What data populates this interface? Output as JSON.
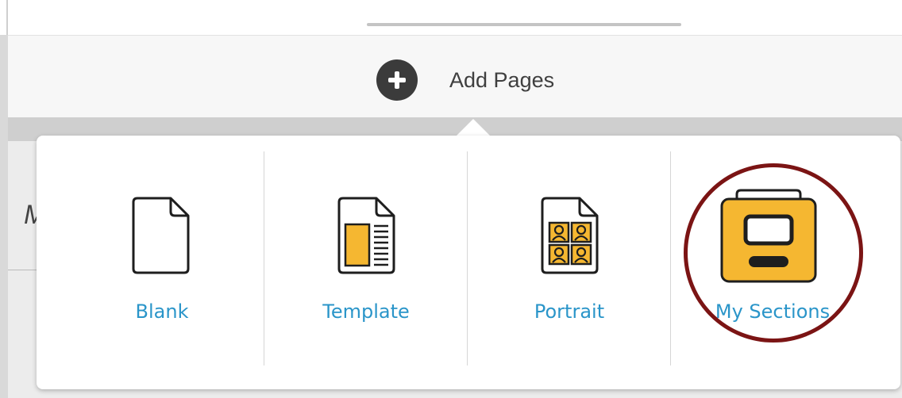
{
  "header": {
    "add_pages_label": "Add Pages"
  },
  "background": {
    "partial_letter": "M"
  },
  "add_pages_menu": {
    "options": [
      {
        "label": "Blank",
        "icon": "blank-page-icon"
      },
      {
        "label": "Template",
        "icon": "template-page-icon"
      },
      {
        "label": "Portrait",
        "icon": "portrait-page-icon"
      },
      {
        "label": "My Sections",
        "icon": "my-sections-folder-icon"
      }
    ]
  },
  "colors": {
    "label_blue": "#2a95c9",
    "icon_yellow": "#f5b731",
    "highlight_ring": "#7b1414",
    "add_icon_bg": "#3b3b3b"
  }
}
